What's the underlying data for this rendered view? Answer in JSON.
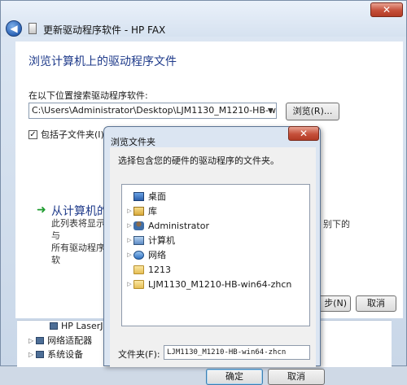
{
  "wizard": {
    "title": "更新驱动程序软件 - HP FAX",
    "close_glyph": "✕",
    "back_glyph": "◀",
    "heading": "浏览计算机上的驱动程序文件",
    "search_label": "在以下位置搜索驱动程序软件:",
    "path_value": "C:\\Users\\Administrator\\Desktop\\LJM1130_M1210-HB-win64-",
    "browse_button": "浏览(R)...",
    "include_subfolders_label": "包括子文件夹(I)",
    "include_subfolders_checked": "✓",
    "pick_link": "从计算机的",
    "pick_desc_line1": "此列表将显示与",
    "pick_desc_right": "别下的",
    "pick_desc_line2": "所有驱动程序软",
    "next_button": "步(N)",
    "cancel_button": "取消"
  },
  "device_tree": {
    "items": [
      {
        "label": "HP LaserJe"
      },
      {
        "label": "网络适配器"
      },
      {
        "label": "系统设备"
      }
    ]
  },
  "browse_dialog": {
    "title": "浏览文件夹",
    "close_glyph": "✕",
    "instruction": "选择包含您的硬件的驱动程序的文件夹。",
    "tree": [
      {
        "label": "桌面",
        "icon": "desktop-icon",
        "expander": ""
      },
      {
        "label": "库",
        "icon": "library-icon",
        "expander": "▷"
      },
      {
        "label": "Administrator",
        "icon": "user-icon",
        "expander": "▷"
      },
      {
        "label": "计算机",
        "icon": "computer-icon",
        "expander": "▷"
      },
      {
        "label": "网络",
        "icon": "network-icon",
        "expander": "▷"
      },
      {
        "label": "1213",
        "icon": "folder-icon",
        "expander": ""
      },
      {
        "label": "LJM1130_M1210-HB-win64-zhcn",
        "icon": "folder-icon",
        "expander": "▷"
      }
    ],
    "folder_label": "文件夹(F):",
    "folder_value": "LJM1130_M1210-HB-win64-zhcn",
    "ok_button": "确定",
    "cancel_button": "取消"
  }
}
